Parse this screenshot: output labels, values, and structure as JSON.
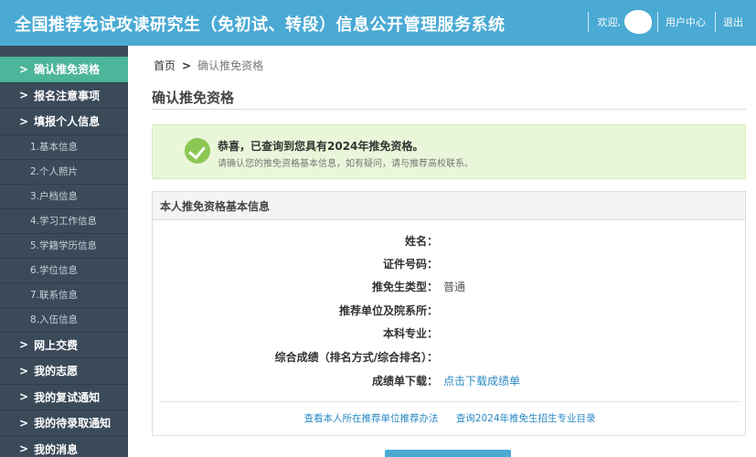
{
  "header": {
    "title": "全国推荐免试攻读研究生（免初试、转段）信息公开管理服务系统",
    "welcome": "欢迎,",
    "user_center": "用户中心",
    "logout": "退出"
  },
  "sidebar": {
    "items": [
      {
        "label": "确认推免资格",
        "chevron": ">"
      },
      {
        "label": "报名注意事项",
        "chevron": ">"
      },
      {
        "label": "填报个人信息",
        "chevron": ">"
      },
      {
        "label": "1.基本信息"
      },
      {
        "label": "2.个人照片"
      },
      {
        "label": "3.户档信息"
      },
      {
        "label": "4.学习工作信息"
      },
      {
        "label": "5.学籍学历信息"
      },
      {
        "label": "6.学位信息"
      },
      {
        "label": "7.联系信息"
      },
      {
        "label": "8.入伍信息"
      },
      {
        "label": "网上交费",
        "chevron": ">"
      },
      {
        "label": "我的志愿",
        "chevron": ">"
      },
      {
        "label": "我的复试通知",
        "chevron": ">"
      },
      {
        "label": "我的待录取通知",
        "chevron": ">"
      },
      {
        "label": "我的消息",
        "chevron": ">"
      }
    ]
  },
  "breadcrumb": {
    "home": "首页",
    "separator": ">",
    "current": "确认推免资格"
  },
  "page_title": "确认推免资格",
  "alert": {
    "message": "恭喜，已查询到您具有2024年推免资格。",
    "sub_message": "请确认您的推免资格基本信息，如有疑问，请与推荐高校联系。"
  },
  "panel": {
    "title": "本人推免资格基本信息",
    "fields": [
      {
        "label": "姓名：",
        "value": ""
      },
      {
        "label": "证件号码：",
        "value": ""
      },
      {
        "label": "推免生类型：",
        "value": "普通"
      },
      {
        "label": "推荐单位及院系所：",
        "value": ""
      },
      {
        "label": "本科专业：",
        "value": ""
      },
      {
        "label": "综合成绩（排名方式/综合排名）：",
        "value": ""
      },
      {
        "label": "成绩单下载：",
        "value": "点击下载成绩单"
      }
    ],
    "links": {
      "method": "查看本人所在推荐单位推荐办法",
      "catalog": "查询2024年推免生招生专业目录"
    }
  },
  "colors": {
    "header": "#4aaad4",
    "sidebar": "#3a4a59",
    "active": "#4cb59a",
    "success": "#8cc752",
    "link": "#2a8ac4"
  }
}
